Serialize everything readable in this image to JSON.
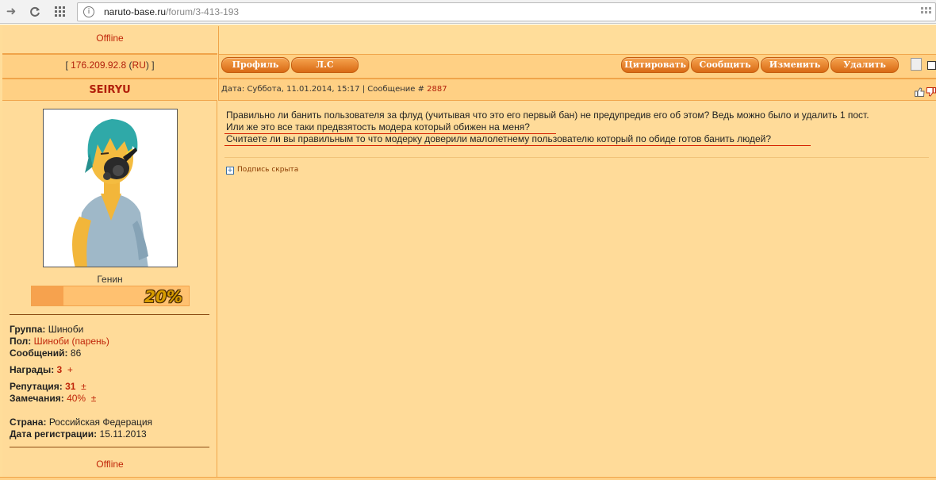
{
  "browser": {
    "back_icon": "arrow-right-icon",
    "reload_icon": "reload-icon",
    "apps_icon": "apps-grid-icon",
    "url_host": "naruto-base.ru",
    "url_path": "/forum/3-413-193"
  },
  "top": {
    "offline": "Offline"
  },
  "ip_row": {
    "bracket_open": "[ ",
    "ip": "176.209.92.8",
    "country_open": " (",
    "country": "RU",
    "country_close": ") ]"
  },
  "buttons": {
    "profile": "Профиль",
    "pm": "Л.С",
    "quote": "Цитировать",
    "message": "Сообщить",
    "edit": "Изменить",
    "delete": "Удалить"
  },
  "user": {
    "name": "SEIRYU",
    "rank": "Генин",
    "level_percent": 20,
    "level_label": "20%",
    "group_label": "Группа:",
    "group": "Шиноби",
    "gender_label": "Пол:",
    "gender": "Шиноби (парень)",
    "posts_label": "Сообщений:",
    "posts": "86",
    "awards_label": "Награды:",
    "awards": "3",
    "awards_plus": "+",
    "reputation_label": "Репутация:",
    "reputation": "31",
    "reputation_pm": "±",
    "warnings_label": "Замечания:",
    "warnings": "40%",
    "warnings_pm": "±",
    "country_label": "Страна:",
    "country": "Российская Федерация",
    "registered_label": "Дата регистрации:",
    "registered": "15.11.2013",
    "offline": "Offline"
  },
  "post": {
    "meta_prefix": "Дата: Суббота, 11.01.2014, 15:17 | Сообщение # ",
    "number": "2887",
    "line1": "Правильно ли банить пользователя за флуд (учитывая что это его первый бан) не предупредив его об этом? Ведь можно было и удалить 1 пост.",
    "line2": "Или же это все таки предвзятость модера который обижен на меня?",
    "line3": "Считаете ли вы правильным то что модерку доверили малолетнему пользователю который по обиде готов банить людей?",
    "signature": "Подпись скрыта",
    "signature_icon": "plus-box-icon"
  },
  "colors": {
    "background": "#ffdb99",
    "band": "#ffd084",
    "accent": "#c0260a",
    "button": "#e07b24"
  }
}
